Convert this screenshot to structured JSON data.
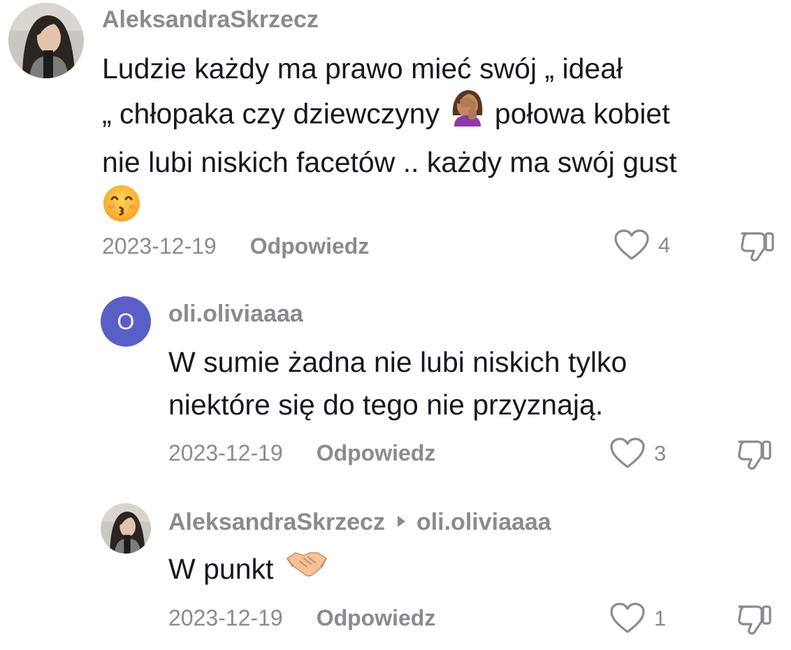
{
  "comments": [
    {
      "username": "AleksandraSkrzecz",
      "text_line1": "Ludzie każdy ma prawo mieć swój „ ideał",
      "text_line2a": "„ chłopaka czy dziewczyny",
      "text_line2b": "połowa kobiet",
      "text_line3": "nie lubi niskich facetów .. każdy ma swój gust",
      "date": "2023-12-19",
      "reply_label": "Odpowiedz",
      "likes": "4"
    },
    {
      "avatar_letter": "O",
      "username": "oli.oliviaaaa",
      "text_line1": "W sumie żadna nie lubi niskich tylko",
      "text_line2": "niektóre się do tego nie przyznają.",
      "date": "2023-12-19",
      "reply_label": "Odpowiedz",
      "likes": "3"
    },
    {
      "username": "AleksandraSkrzecz",
      "reply_to": "oli.oliviaaaa",
      "text": "W punkt",
      "date": "2023-12-19",
      "reply_label": "Odpowiedz",
      "likes": "1"
    }
  ],
  "icons": {
    "like": "heart-outline-icon",
    "dislike": "thumbs-down-outline-icon",
    "emoji1": "woman-facepalming-emoji",
    "emoji2": "kissing-smiling-eyes-emoji",
    "emoji3": "handshake-emoji"
  },
  "colors": {
    "text": "#161823",
    "muted": "#8a8b91",
    "avatar_letter_bg": "#5a5fc8"
  }
}
